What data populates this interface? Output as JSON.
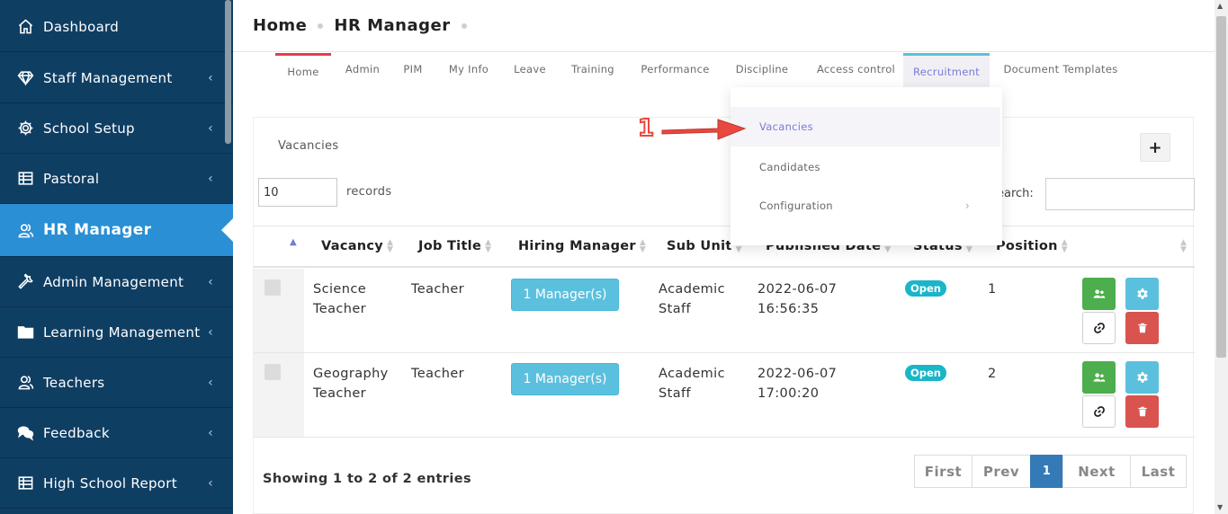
{
  "sidebar": {
    "items": [
      {
        "label": "Dashboard",
        "icon": "home-icon"
      },
      {
        "label": "Staff Management",
        "icon": "diamond-icon"
      },
      {
        "label": "School Setup",
        "icon": "gear-icon"
      },
      {
        "label": "Pastoral",
        "icon": "table-icon"
      },
      {
        "label": "HR Manager",
        "icon": "user-group-icon"
      },
      {
        "label": "Admin Management",
        "icon": "wrench-icon"
      },
      {
        "label": "Learning Management",
        "icon": "folder-icon"
      },
      {
        "label": "Teachers",
        "icon": "user-group-icon"
      },
      {
        "label": "Feedback",
        "icon": "chat-icon"
      },
      {
        "label": "High School Report",
        "icon": "table-icon"
      }
    ],
    "chevron": "‹"
  },
  "breadcrumb": {
    "home": "Home",
    "current": "HR Manager"
  },
  "tabs": [
    "Home",
    "Admin",
    "PIM",
    "My Info",
    "Leave",
    "Training",
    "Performance",
    "Discipline",
    "Access control",
    "Recruitment",
    "Document Templates"
  ],
  "dropdown": {
    "items": [
      "Vacancies",
      "Candidates",
      "Configuration"
    ],
    "chevron": "›"
  },
  "annotation": {
    "step": "1",
    "color": "#e8483f"
  },
  "card": {
    "title": "Vacancies",
    "add_label": "+",
    "length_value": "10",
    "length_label": "records",
    "search_label": "earch:"
  },
  "table": {
    "headers": [
      "Vacancy",
      "Job Title",
      "Hiring Manager",
      "Sub Unit",
      "Published Date",
      "Status",
      "Position"
    ],
    "rows": [
      {
        "vacancy": [
          "Science",
          "Teacher"
        ],
        "job_title": "Teacher",
        "manager_btn": "1 Manager(s)",
        "sub_unit": [
          "Academic",
          "Staff"
        ],
        "date": [
          "2022-06-07",
          "16:56:35"
        ],
        "status": "Open",
        "position": "1"
      },
      {
        "vacancy": [
          "Geography",
          "Teacher"
        ],
        "job_title": "Teacher",
        "manager_btn": "1 Manager(s)",
        "sub_unit": [
          "Academic",
          "Staff"
        ],
        "date": [
          "2022-06-07",
          "17:00:20"
        ],
        "status": "Open",
        "position": "2"
      }
    ]
  },
  "footer": {
    "info": "Showing 1 to 2 of 2 entries",
    "pager": [
      "First",
      "Prev",
      "1",
      "Next",
      "Last"
    ]
  },
  "colors": {
    "sidebar": "#0f3e63",
    "active": "#2a8fd4",
    "accent": "#5bc0de",
    "danger": "#d9534f",
    "success": "#4cae4c"
  }
}
